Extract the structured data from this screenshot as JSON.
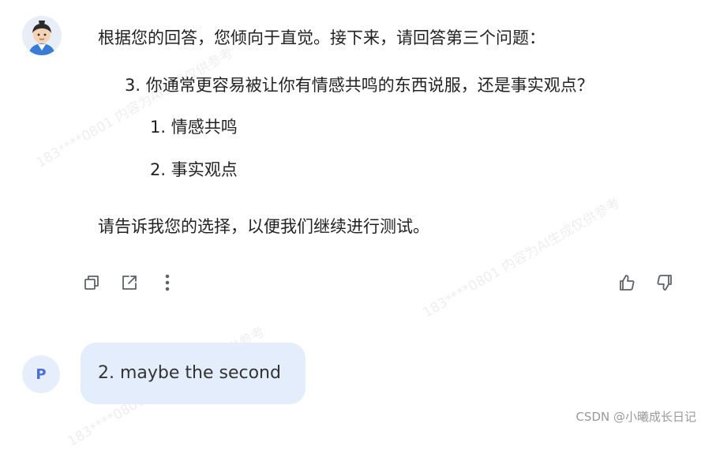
{
  "assistant": {
    "intro": "根据您的回答，您倾向于直觉。接下来，请回答第三个问题：",
    "question": "3. 你通常更容易被让你有情感共鸣的东西说服，还是事实观点？",
    "options": [
      "1. 情感共鸣",
      "2. 事实观点"
    ],
    "closing": "请告诉我您的选择，以便我们继续进行测试。"
  },
  "actions": {
    "copy_icon": "copy-icon",
    "share_icon": "share-icon",
    "more_icon": "more-vertical-icon",
    "like_icon": "thumbs-up-icon",
    "dislike_icon": "thumbs-down-icon"
  },
  "user": {
    "avatar_letter": "P",
    "message": "2. maybe the second"
  },
  "watermark_text": "183****0801 内容为AI生成仅供参考",
  "credit": "CSDN @小曦成长日记",
  "colors": {
    "user_bubble": "#e3edfb",
    "user_avatar_bg": "#e6eefc",
    "user_avatar_text": "#4a6fd8",
    "icon": "#5f6368"
  }
}
